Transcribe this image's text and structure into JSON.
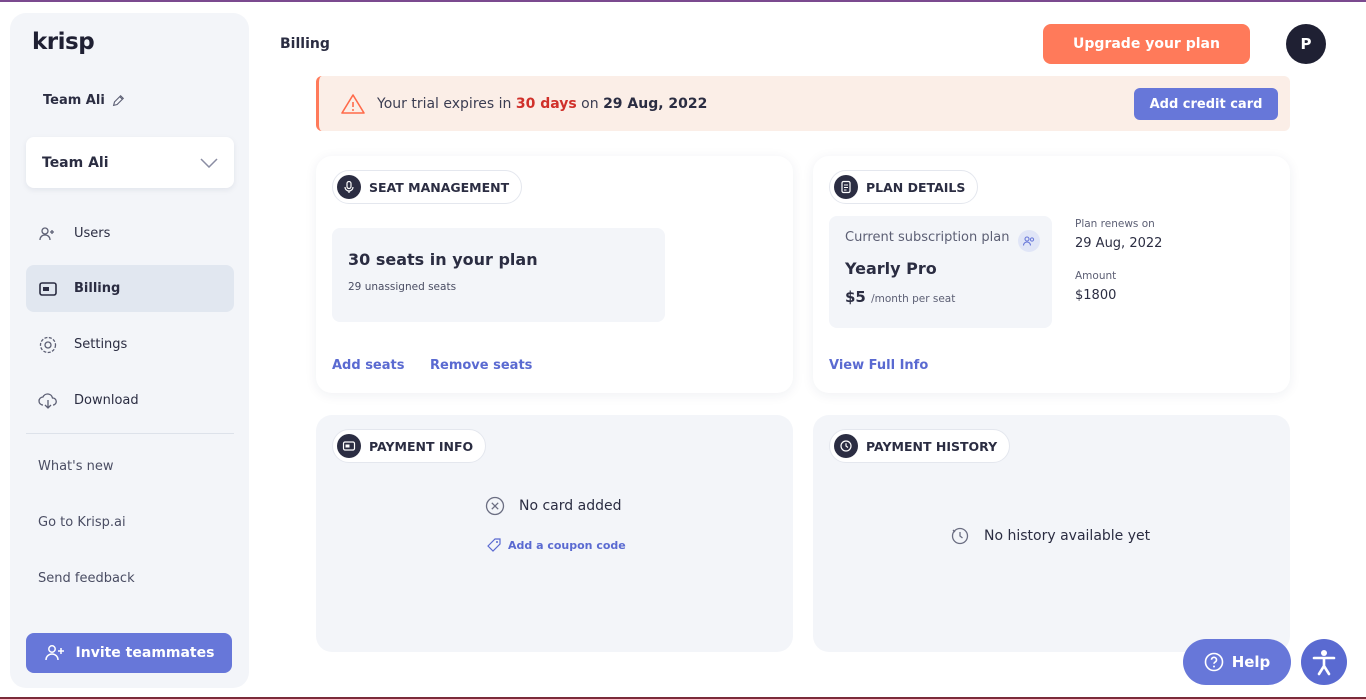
{
  "app": {
    "logo": "krisp"
  },
  "sidebar": {
    "team_label": "Team Ali",
    "team_select": "Team Ali",
    "nav": [
      {
        "label": "Users",
        "icon": "users-icon"
      },
      {
        "label": "Billing",
        "icon": "card-icon"
      },
      {
        "label": "Settings",
        "icon": "gear-icon"
      },
      {
        "label": "Download",
        "icon": "cloud-download-icon"
      }
    ],
    "links": [
      "What's new",
      "Go to Krisp.ai",
      "Send feedback"
    ],
    "invite_label": "Invite teammates"
  },
  "header": {
    "title": "Billing",
    "upgrade_label": "Upgrade your plan",
    "avatar_initial": "P"
  },
  "banner": {
    "text_before": "Your trial expires in",
    "days": "30 days",
    "text_on": "on",
    "date": "29 Aug, 2022",
    "button_label": "Add credit card"
  },
  "seat_management": {
    "title": "SEAT MANAGEMENT",
    "seats_text": "30 seats in your plan",
    "unassigned_text": "29 unassigned seats",
    "add_label": "Add seats",
    "remove_label": "Remove seats"
  },
  "plan_details": {
    "title": "PLAN DETAILS",
    "current_label": "Current subscription plan",
    "plan_name": "Yearly Pro",
    "price": "$5",
    "price_unit": "/month per seat",
    "renews_label": "Plan renews on",
    "renews_date": "29 Aug, 2022",
    "amount_label": "Amount",
    "amount_value": "$1800",
    "view_label": "View Full Info"
  },
  "payment_info": {
    "title": "PAYMENT INFO",
    "empty_text": "No card added",
    "coupon_label": "Add a coupon code"
  },
  "payment_history": {
    "title": "PAYMENT HISTORY",
    "empty_text": "No history available yet"
  },
  "help": {
    "label": "Help"
  },
  "colors": {
    "accent": "#6777d9",
    "cta": "#ff7a5a",
    "warning": "#d0302a"
  }
}
